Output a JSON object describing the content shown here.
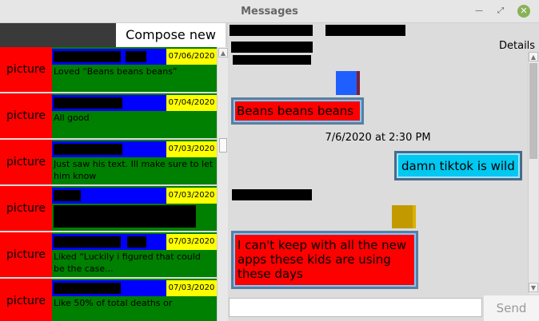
{
  "window": {
    "title": "Messages",
    "min_icon": "minimize-icon",
    "max_icon": "maximize-icon",
    "close_icon": "close-icon"
  },
  "compose": {
    "label": "Compose new"
  },
  "conversations": [
    {
      "picture": "picture",
      "date": "07/06/2020",
      "preview": "Loved “Beans beans beans”",
      "preview_redacted": false
    },
    {
      "picture": "picture",
      "date": "07/04/2020",
      "preview": "All good",
      "preview_redacted": false
    },
    {
      "picture": "picture",
      "date": "07/03/2020",
      "preview": "Just saw his text. Ill make sure to let him know",
      "preview_redacted": false
    },
    {
      "picture": "picture",
      "date": "07/03/2020",
      "preview": "",
      "preview_redacted": true
    },
    {
      "picture": "picture",
      "date": "07/03/2020",
      "preview": "Liked “Luckily i figured that could be the case...",
      "preview_redacted": false
    },
    {
      "picture": "picture",
      "date": "07/03/2020",
      "preview": "Like 50% of total deaths or",
      "preview_redacted": false
    }
  ],
  "thread": {
    "details_label": "Details",
    "messages": [
      {
        "text": "Beans beans beans",
        "from": "other"
      },
      {
        "timestamp": "7/6/2020 at 2:30 PM"
      },
      {
        "text": "damn tiktok is wild",
        "from": "me"
      },
      {
        "text": "I can't keep with all the new apps these kids are using these days",
        "from": "other"
      }
    ]
  },
  "message_input": {
    "value": "",
    "placeholder": ""
  },
  "send": {
    "label": "Send"
  },
  "colors": {
    "picture_bg": "#ff0000",
    "preview_bg": "#008000",
    "name_bar": "#0000ff",
    "date_bg": "#ffff00",
    "bubble_other": "#ff0000",
    "bubble_me": "#00c8f0"
  }
}
